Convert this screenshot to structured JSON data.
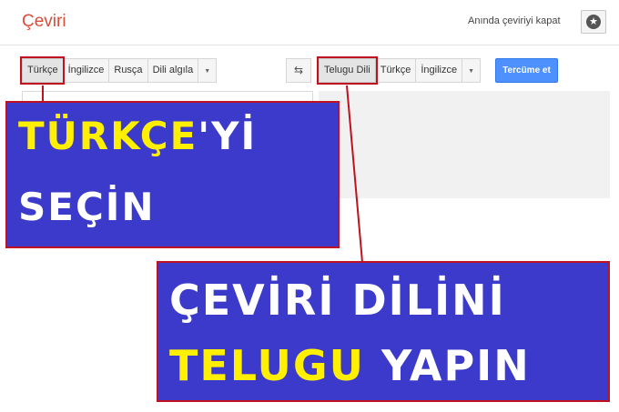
{
  "header": {
    "title": "Çeviri",
    "instant_label": "Anında çeviriyi kapat",
    "star_icon": "star-icon"
  },
  "source_langs": [
    "Türkçe",
    "İngilizce",
    "Rusça",
    "Dili algıla"
  ],
  "target_langs": [
    "Telugu Dili",
    "Türkçe",
    "İngilizce"
  ],
  "swap_icon": "⇆",
  "dropdown_icon": "▼",
  "translate_label": "Tercüme et",
  "selected": {
    "source": "Türkçe",
    "target": "Telugu Dili"
  },
  "callout_1": {
    "line1_yellow": "TÜRKÇE",
    "line1_white": "'Yİ",
    "line2_white": "SEÇİN"
  },
  "callout_2": {
    "line1_white": "ÇEVİRİ DİLİNİ",
    "line2_yellow": "TELUGU",
    "line2_white": " YAPIN"
  },
  "colors": {
    "accent_red": "#dd4b39",
    "callout_bg": "#3b3acb",
    "callout_highlight": "#ffef00",
    "annotation_red": "#c0121e",
    "button_blue": "#4d90fe"
  }
}
